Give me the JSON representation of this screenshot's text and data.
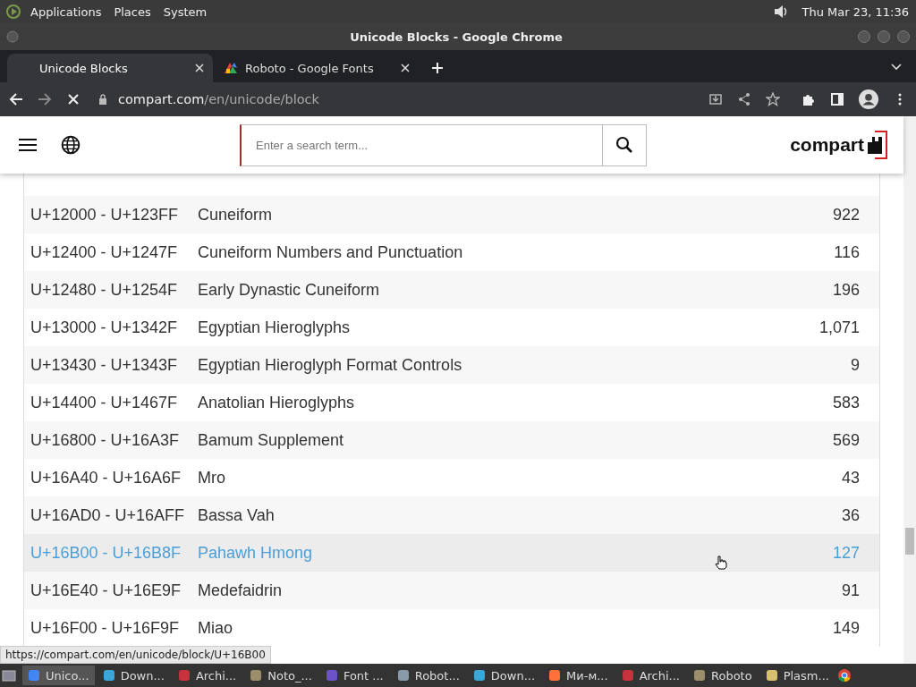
{
  "top_panel": {
    "menus": [
      "Applications",
      "Places",
      "System"
    ],
    "clock": "Thu Mar 23, 11:36"
  },
  "window": {
    "title": "Unicode Blocks - Google Chrome"
  },
  "tabs": [
    {
      "label": "Unicode Blocks",
      "selected": true
    },
    {
      "label": "Roboto - Google Fonts",
      "selected": false
    }
  ],
  "address": {
    "domain": "compart.com",
    "path": "/en/unicode/block"
  },
  "header": {
    "search": {
      "placeholder": "Enter a search term..."
    },
    "logo": "compart"
  },
  "rows": [
    {
      "range": "U+12000 - U+123FF",
      "name": "Cuneiform",
      "count": "922",
      "hovered": false
    },
    {
      "range": "U+12400 - U+1247F",
      "name": "Cuneiform Numbers and Punctuation",
      "count": "116",
      "hovered": false
    },
    {
      "range": "U+12480 - U+1254F",
      "name": "Early Dynastic Cuneiform",
      "count": "196",
      "hovered": false
    },
    {
      "range": "U+13000 - U+1342F",
      "name": "Egyptian Hieroglyphs",
      "count": "1,071",
      "hovered": false
    },
    {
      "range": "U+13430 - U+1343F",
      "name": "Egyptian Hieroglyph Format Controls",
      "count": "9",
      "hovered": false
    },
    {
      "range": "U+14400 - U+1467F",
      "name": "Anatolian Hieroglyphs",
      "count": "583",
      "hovered": false
    },
    {
      "range": "U+16800 - U+16A3F",
      "name": "Bamum Supplement",
      "count": "569",
      "hovered": false
    },
    {
      "range": "U+16A40 - U+16A6F",
      "name": "Mro",
      "count": "43",
      "hovered": false
    },
    {
      "range": "U+16AD0 - U+16AFF",
      "name": "Bassa Vah",
      "count": "36",
      "hovered": false
    },
    {
      "range": "U+16B00 - U+16B8F",
      "name": "Pahawh Hmong",
      "count": "127",
      "hovered": true
    },
    {
      "range": "U+16E40 - U+16E9F",
      "name": "Medefaidrin",
      "count": "91",
      "hovered": false
    },
    {
      "range": "U+16F00 - U+16F9F",
      "name": "Miao",
      "count": "149",
      "hovered": false
    }
  ],
  "status_url": "https://compart.com/en/unicode/block/U+16B00",
  "taskbar": [
    {
      "label": "Unico...",
      "selected": true
    },
    {
      "label": "Down...",
      "selected": false
    },
    {
      "label": "Archi...",
      "selected": false
    },
    {
      "label": "Noto_...",
      "selected": false
    },
    {
      "label": "Font ...",
      "selected": false
    },
    {
      "label": "Robot...",
      "selected": false
    },
    {
      "label": "Down...",
      "selected": false
    },
    {
      "label": "Ми-м...",
      "selected": false
    },
    {
      "label": "Archi...",
      "selected": false
    },
    {
      "label": "Roboto",
      "selected": false
    },
    {
      "label": "Plasm...",
      "selected": false
    }
  ]
}
